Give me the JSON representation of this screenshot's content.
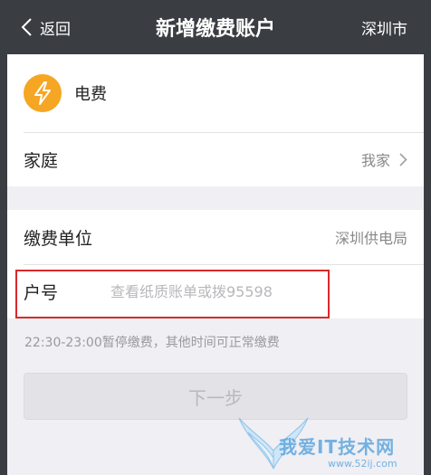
{
  "nav": {
    "back_label": "返回",
    "title": "新增缴费账户",
    "city": "深圳市"
  },
  "bill_type": {
    "label": "电费",
    "icon": "lightning-bolt-icon",
    "color": "#f5a623"
  },
  "household": {
    "label": "家庭",
    "value": "我家"
  },
  "company": {
    "label": "缴费单位",
    "value": "深圳供电局"
  },
  "account": {
    "label": "户号",
    "placeholder": "查看纸质账单或拨95598",
    "value": ""
  },
  "notice": "22:30-23:00暂停缴费，其他时间可正常缴费",
  "next_button": {
    "label": "下一步",
    "enabled": false
  },
  "watermark": {
    "text": "我爱IT技术网",
    "url": "www.52ij.com"
  }
}
